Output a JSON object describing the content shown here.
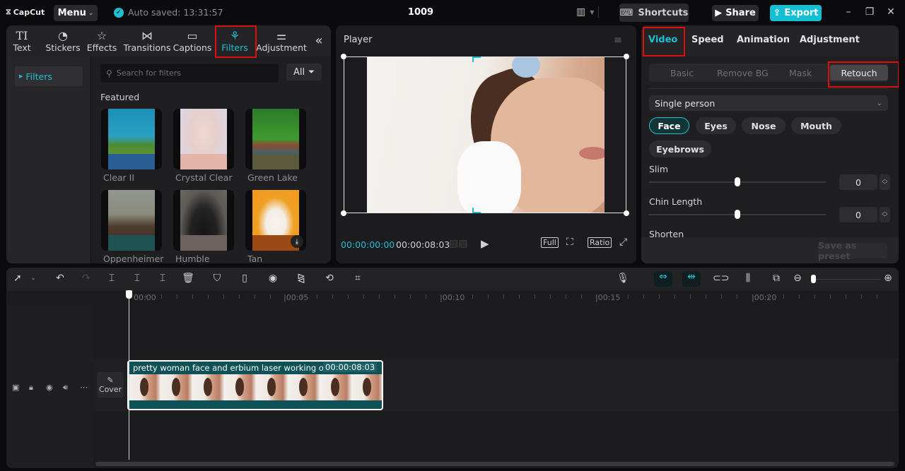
{
  "app": {
    "name": "CapCut",
    "menu_label": "Menu",
    "autosave": "Auto saved: 13:31:57",
    "project_title": "1009"
  },
  "topbar": {
    "shortcuts_label": "Shortcuts",
    "share_label": "Share",
    "export_label": "Export",
    "accent": "#14bfd4"
  },
  "left_panel": {
    "tools": [
      {
        "label": "Text",
        "icon": "text-icon"
      },
      {
        "label": "Stickers",
        "icon": "sticker-icon"
      },
      {
        "label": "Effects",
        "icon": "effects-icon"
      },
      {
        "label": "Transitions",
        "icon": "transitions-icon"
      },
      {
        "label": "Captions",
        "icon": "captions-icon"
      },
      {
        "label": "Filters",
        "icon": "filters-icon",
        "active": true
      },
      {
        "label": "Adjustment",
        "icon": "adjustment-icon"
      }
    ],
    "nav_item": "Filters",
    "search_placeholder": "Search for filters",
    "filter_dropdown": "All",
    "section_title": "Featured",
    "filters": [
      {
        "name": "Clear II",
        "strip": "#2a5d94"
      },
      {
        "name": "Crystal Clear",
        "strip": "#e4b4a8"
      },
      {
        "name": "Green Lake",
        "strip": "#5b5a3c"
      },
      {
        "name": "Oppenheimer",
        "strip": "#1f5253"
      },
      {
        "name": "Humble",
        "strip": "#6c625e"
      },
      {
        "name": "Tan",
        "strip": "#9a4a12"
      }
    ]
  },
  "player": {
    "title": "Player",
    "current_time": "00:00:00:00",
    "total_time": "00:00:08:03",
    "full_label": "Full",
    "ratio_label": "Ratio"
  },
  "right_panel": {
    "tabs": [
      "Video",
      "Speed",
      "Animation",
      "Adjustment"
    ],
    "active_tab": "Video",
    "subtabs": [
      "Basic",
      "Remove BG",
      "Mask",
      "Retouch"
    ],
    "active_subtab": "Retouch",
    "person_select": "Single person",
    "features": [
      "Face",
      "Eyes",
      "Nose",
      "Mouth",
      "Eyebrows"
    ],
    "active_feature": "Face",
    "sliders": [
      {
        "label": "Slim",
        "value": "0"
      },
      {
        "label": "Chin Length",
        "value": "0"
      }
    ],
    "next_label": "Shorten",
    "save_preset_label": "Save as preset"
  },
  "timeline": {
    "ruler": [
      "00:00",
      "00:05",
      "00:10",
      "00:15",
      "00:20"
    ],
    "cover_label": "Cover",
    "clip": {
      "title": "pretty woman face and erbium laser working on it",
      "duration": "00:00:08:03"
    }
  }
}
